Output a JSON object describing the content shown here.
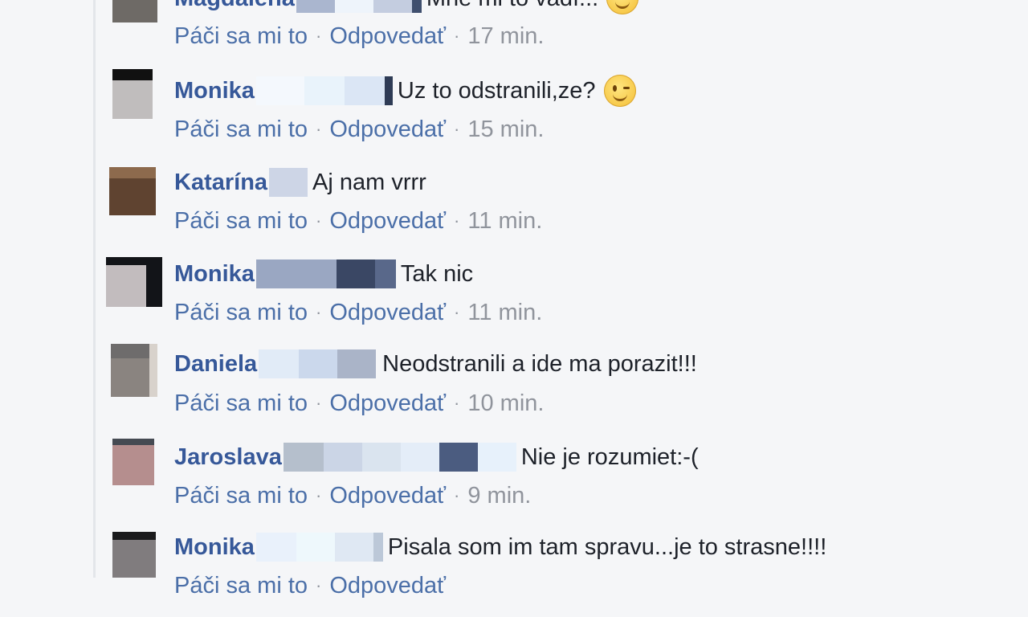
{
  "actions": {
    "like_label": "Páči sa mi to",
    "reply_label": "Odpovedať",
    "separator": "·"
  },
  "comments": [
    {
      "author": "Magdalena",
      "text": "Mne mi to vadí...",
      "time": "17 min.",
      "emoji": "smile"
    },
    {
      "author": "Monika",
      "text": "Uz to odstranili,ze?",
      "time": "15 min.",
      "emoji": "wink"
    },
    {
      "author": "Katarína",
      "text": "Aj nam vrrr",
      "time": "11 min.",
      "emoji": ""
    },
    {
      "author": "Monika",
      "text": "Tak nic",
      "time": "11 min.",
      "emoji": ""
    },
    {
      "author": "Daniela",
      "text": "Neodstranili a ide ma porazit!!!",
      "time": "10 min.",
      "emoji": ""
    },
    {
      "author": "Jaroslava",
      "text": "Nie je rozumiet:-(",
      "time": "9 min.",
      "emoji": ""
    },
    {
      "author": "Monika",
      "text": "Pisala som im tam spravu...je to strasne!!!!",
      "time": "",
      "emoji": ""
    }
  ],
  "colors": {
    "author": "#365899",
    "action": "#4b6fa8",
    "muted": "#90949c",
    "text": "#1d2129",
    "background": "#f5f6f8"
  }
}
